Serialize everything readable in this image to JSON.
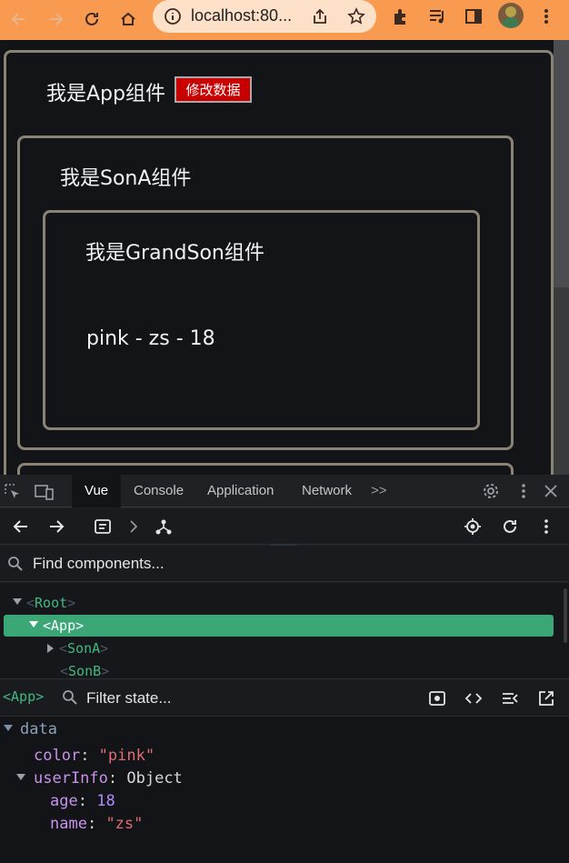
{
  "browser": {
    "url": "localhost:80...",
    "colors": {
      "chrome": "#f89a4f",
      "omnibox": "#fde0c8"
    }
  },
  "page": {
    "app_title": "我是App组件",
    "edit_button": "修改数据",
    "sona_title": "我是SonA组件",
    "grandson_title": "我是GrandSon组件",
    "grandson_info": "pink - zs - 18"
  },
  "devtools": {
    "tabs": [
      "Vue",
      "Console",
      "Application",
      "Network"
    ],
    "more_tabs": ">>",
    "find_placeholder": "Find components...",
    "tree": [
      {
        "bracket_open": "<",
        "name": "Root",
        "bracket_close": ">"
      },
      {
        "bracket_open": "<",
        "name": "App",
        "bracket_close": ">"
      },
      {
        "bracket_open": "<",
        "name": "SonA",
        "bracket_close": ">"
      },
      {
        "bracket_open": "<",
        "name": "SonB",
        "bracket_close": ">"
      }
    ],
    "selected_component": "<App>",
    "filter_placeholder": "Filter state...",
    "state": {
      "section": "data",
      "color_key": "color",
      "color_value": "\"pink\"",
      "userinfo_key": "userInfo",
      "userinfo_type": "Object",
      "age_key": "age",
      "age_value": "18",
      "name_key": "name",
      "name_value": "\"zs\""
    },
    "colors": {
      "vue_green": "#42b883",
      "selected_row": "#3ba776"
    }
  }
}
